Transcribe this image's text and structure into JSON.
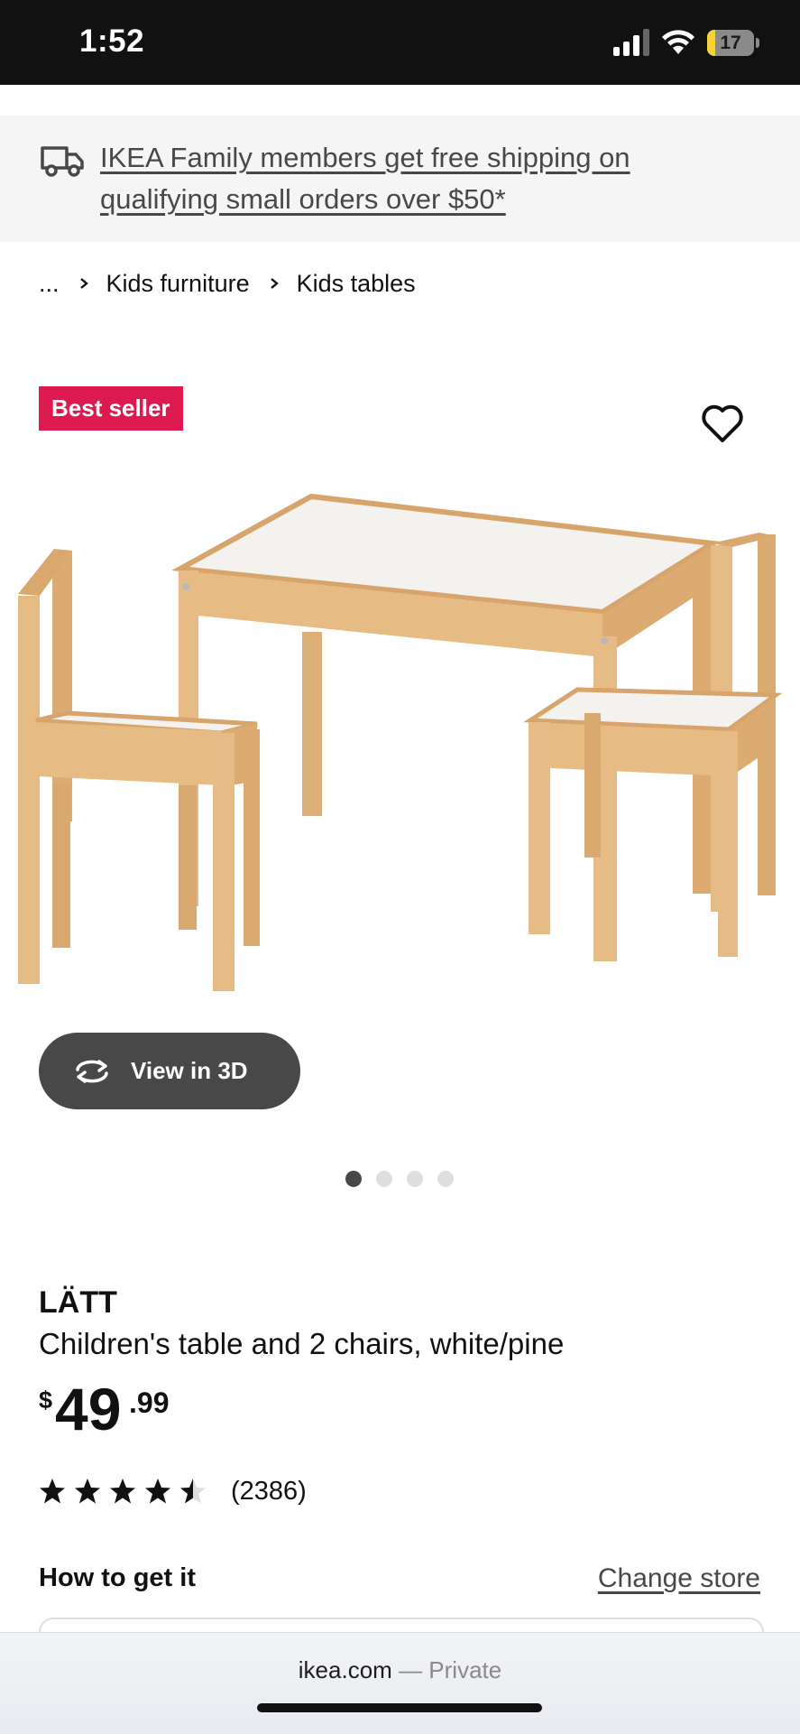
{
  "status_bar": {
    "time": "1:52",
    "battery": "17",
    "battery_fraction": 0.17
  },
  "banner": {
    "shipping_text": "IKEA Family members get free shipping on qualifying small orders over $50*",
    "icon": "truck-icon"
  },
  "breadcrumb": {
    "items": [
      "...",
      "Kids furniture",
      "Kids tables"
    ]
  },
  "gallery": {
    "badge": "Best seller",
    "view_3d_label": "View in 3D",
    "image_count": 4,
    "active_index": 0
  },
  "product": {
    "name": "LÄTT",
    "description": "Children's table and 2 chairs, white/pine",
    "price_currency": "$",
    "price_int": "49",
    "price_dec": ".99",
    "rating": 4.5,
    "review_count": "(2386)"
  },
  "fulfillment": {
    "title": "How to get it",
    "change_store": "Change store"
  },
  "browser": {
    "domain": "ikea.com",
    "mode": "— Private"
  },
  "colors": {
    "badge": "#dd1a4f",
    "dark_button": "#484848",
    "wood": "#e8c08c"
  }
}
